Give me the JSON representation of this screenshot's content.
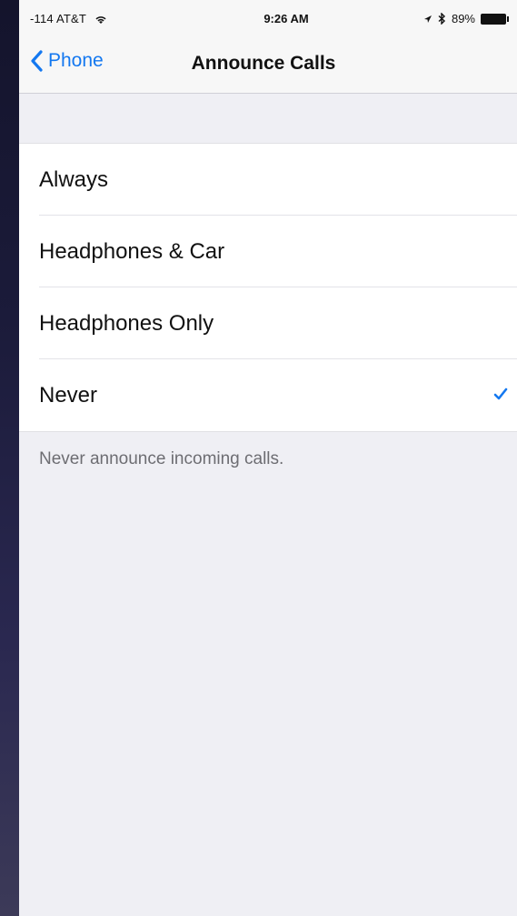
{
  "status_bar": {
    "carrier": "-114 AT&T",
    "time": "9:26 AM",
    "battery": "89%",
    "icons": [
      "wifi-icon",
      "location-icon",
      "bluetooth-icon",
      "battery-icon"
    ]
  },
  "nav": {
    "back_label": "Phone",
    "title": "Announce Calls"
  },
  "options": [
    {
      "label": "Always",
      "selected": false
    },
    {
      "label": "Headphones & Car",
      "selected": false
    },
    {
      "label": "Headphones Only",
      "selected": false
    },
    {
      "label": "Never",
      "selected": true
    }
  ],
  "footer": "Never announce incoming calls.",
  "colors": {
    "accent": "#1478f0",
    "background": "#efeff4",
    "swoosh": "#ff3df0"
  }
}
